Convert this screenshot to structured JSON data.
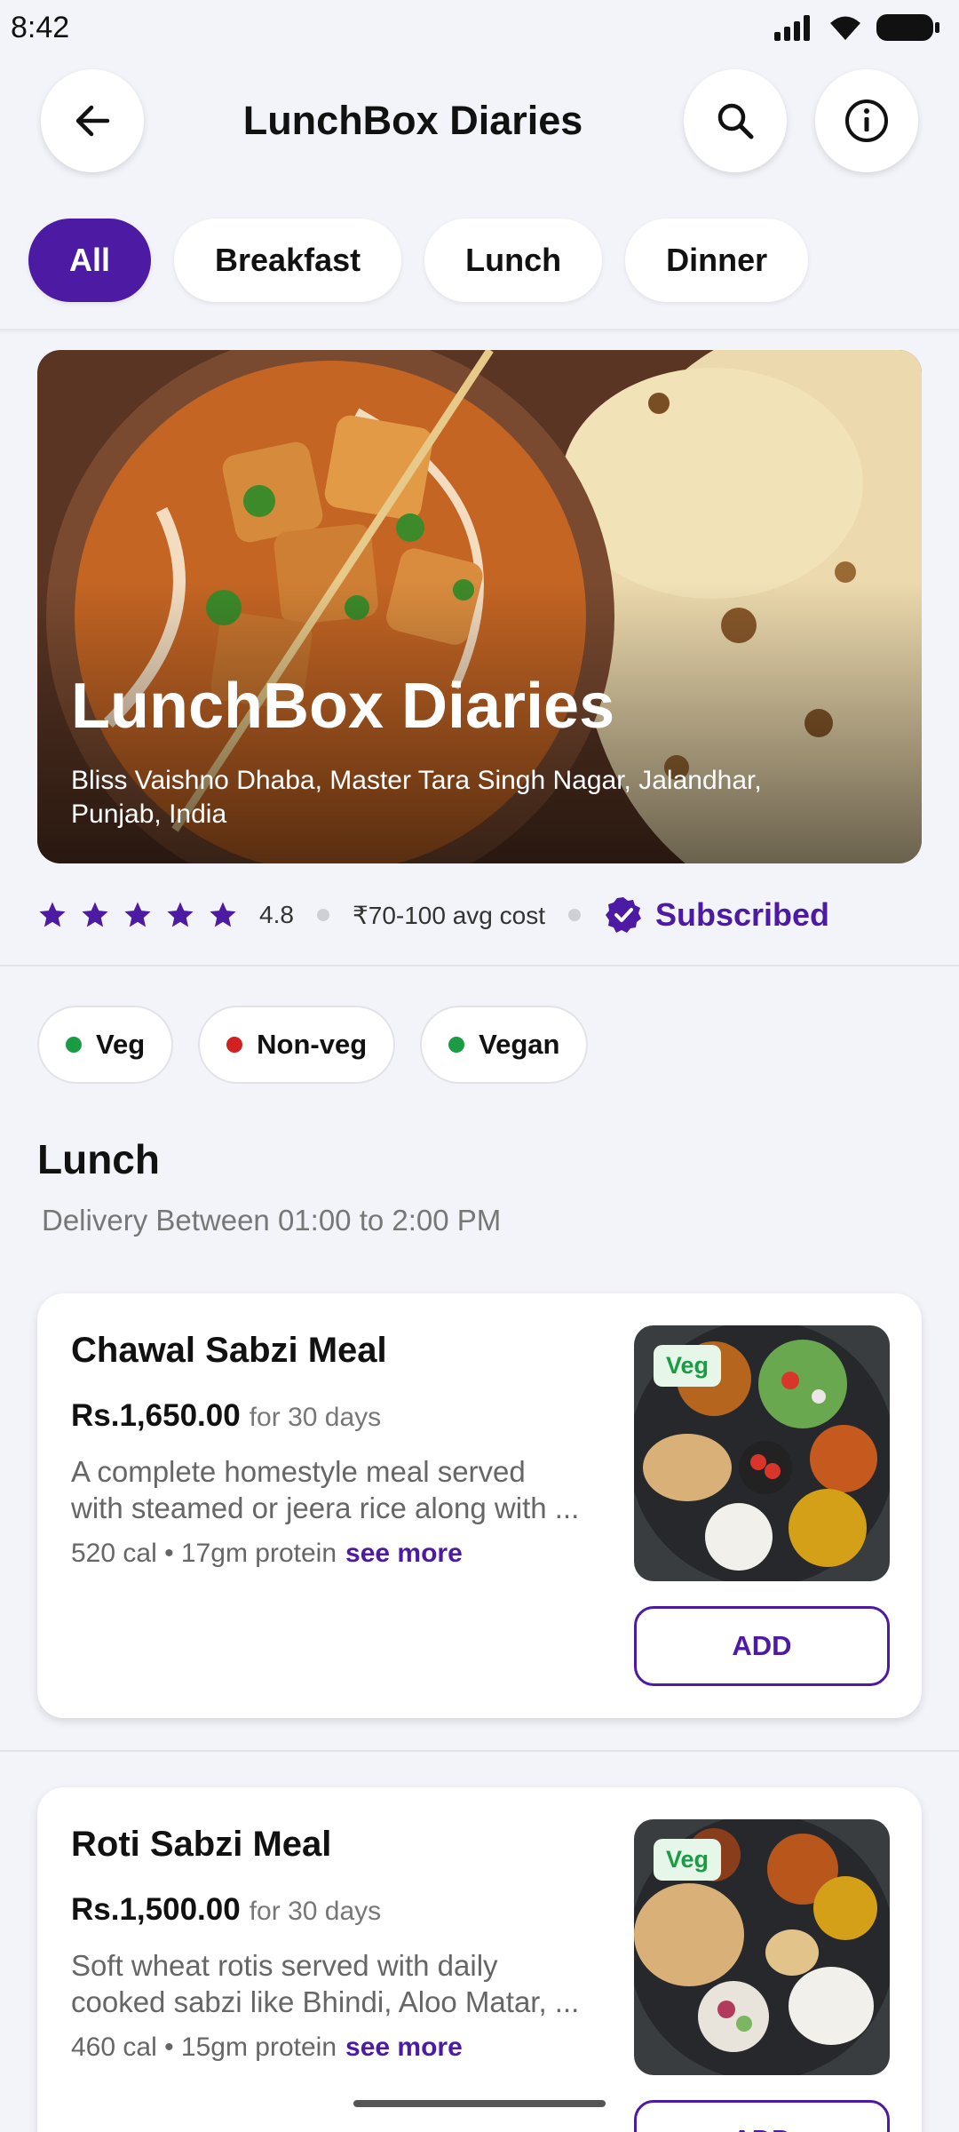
{
  "status": {
    "time": "8:42"
  },
  "header": {
    "title": "LunchBox Diaries",
    "back_icon": "arrow-left-icon",
    "search_icon": "search-icon",
    "info_icon": "info-icon"
  },
  "tabs": [
    {
      "label": "All",
      "active": true
    },
    {
      "label": "Breakfast",
      "active": false
    },
    {
      "label": "Lunch",
      "active": false
    },
    {
      "label": "Dinner",
      "active": false
    }
  ],
  "hero": {
    "title": "LunchBox Diaries",
    "address": "Bliss Vaishno Dhaba, Master Tara Singh Nagar, Jalandhar, Punjab, India"
  },
  "meta": {
    "rating": "4.8",
    "star_count": 5,
    "avg_cost": "₹70-100 avg cost",
    "subscribed": "Subscribed"
  },
  "diet_filters": [
    {
      "label": "Veg",
      "color": "#1a9c44"
    },
    {
      "label": "Non-veg",
      "color": "#d32020"
    },
    {
      "label": "Vegan",
      "color": "#1a9c44"
    }
  ],
  "section": {
    "title": "Lunch",
    "subtitle": "Delivery Between 01:00 to 2:00 PM"
  },
  "meals": [
    {
      "name": "Chawal Sabzi Meal",
      "price": "Rs.1,650.00",
      "period": "for 30 days",
      "desc_line1": "A complete homestyle meal served",
      "desc_line2": "with steamed or jeera rice along with ...",
      "nutrition": "520 cal • 17gm protein",
      "see_more": "see more",
      "tag": "Veg",
      "add_label": "ADD"
    },
    {
      "name": "Roti Sabzi Meal",
      "price": "Rs.1,500.00",
      "period": "for 30 days",
      "desc_line1": "Soft wheat rotis served with daily",
      "desc_line2": "cooked sabzi like Bhindi, Aloo Matar, ...",
      "nutrition": "460 cal • 15gm protein",
      "see_more": "see more",
      "tag": "Veg",
      "add_label": "ADD"
    }
  ],
  "colors": {
    "accent": "#4c1aa3",
    "background": "#f3f4f9",
    "veg_green": "#1a9c44",
    "nonveg_red": "#d32020"
  }
}
